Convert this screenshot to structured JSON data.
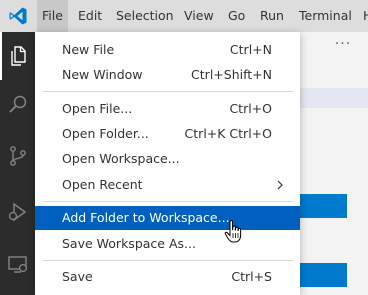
{
  "menubar": {
    "items": [
      {
        "label": "File",
        "active": true
      },
      {
        "label": "Edit"
      },
      {
        "label": "Selection"
      },
      {
        "label": "View"
      },
      {
        "label": "Go"
      },
      {
        "label": "Run"
      },
      {
        "label": "Terminal"
      },
      {
        "label": "H"
      }
    ]
  },
  "activity_bar": {
    "items": [
      "explorer-icon",
      "search-icon",
      "source-control-icon",
      "run-debug-icon",
      "remote-explorer-icon"
    ]
  },
  "editor": {
    "more_actions_label": "···",
    "accent_color": "#007acc"
  },
  "file_menu": {
    "items": [
      {
        "label": "New File",
        "shortcut": "Ctrl+N"
      },
      {
        "label": "New Window",
        "shortcut": "Ctrl+Shift+N"
      },
      {
        "label": "Open File...",
        "shortcut": "Ctrl+O"
      },
      {
        "label": "Open Folder...",
        "shortcut": "Ctrl+K Ctrl+O"
      },
      {
        "label": "Open Workspace...",
        "shortcut": ""
      },
      {
        "label": "Open Recent",
        "shortcut": "",
        "submenu": true
      },
      {
        "label": "Add Folder to Workspace...",
        "shortcut": "",
        "highlighted": true
      },
      {
        "label": "Save Workspace As...",
        "shortcut": ""
      },
      {
        "label": "Save",
        "shortcut": "Ctrl+S"
      }
    ],
    "highlight_color": "#0060c0"
  }
}
